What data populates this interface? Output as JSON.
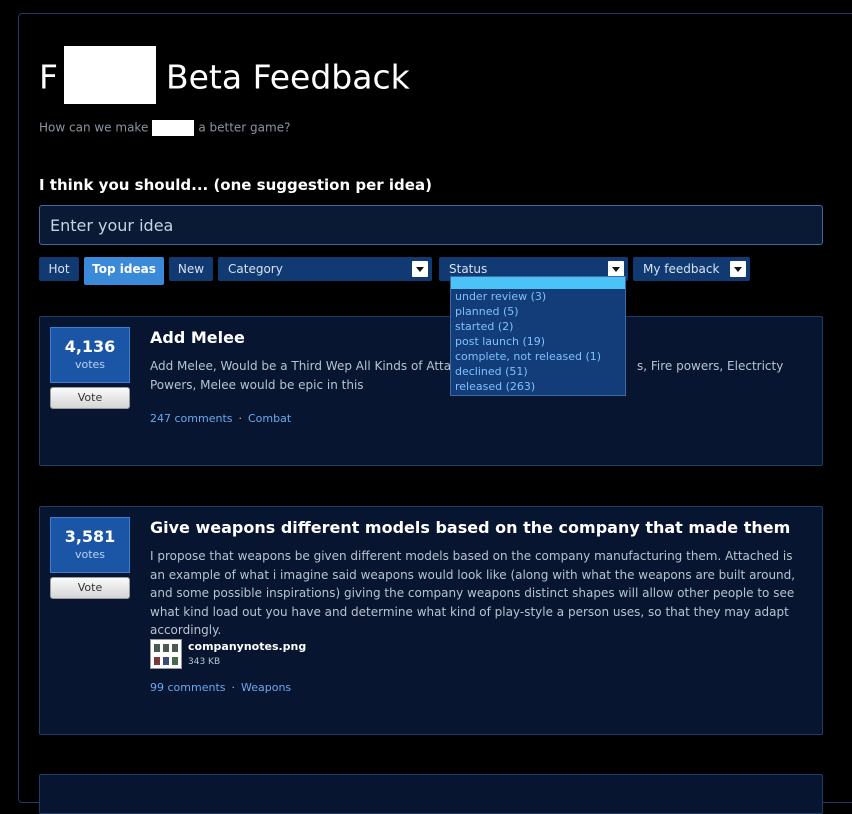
{
  "header": {
    "title_prefix": "F",
    "title_suffix": "Beta Feedback",
    "subtitle_prefix": "How can we make",
    "subtitle_suffix": "a better game?"
  },
  "prompt": "I think you should... (one suggestion per idea)",
  "idea_input": {
    "placeholder": "Enter your idea",
    "value": ""
  },
  "filters": {
    "hot": "Hot",
    "top": "Top ideas",
    "new": "New",
    "category": "Category",
    "status": "Status",
    "my_feedback": "My feedback"
  },
  "status_dropdown": {
    "options": [
      "under review (3)",
      "planned (5)",
      "started (2)",
      "post launch (19)",
      "complete, not released (1)",
      "declined (51)",
      "released (263)"
    ]
  },
  "ideas": [
    {
      "votes": "4,136",
      "votes_label": "votes",
      "vote_button": "Vote",
      "title": "Add Melee",
      "body": "Add Melee, Would be a Third Wep All Kinds of Attac                                               s, Fire powers, Electricty Powers, Melee would be epic in this",
      "comments": "247 comments",
      "category": "Combat"
    },
    {
      "votes": "3,581",
      "votes_label": "votes",
      "vote_button": "Vote",
      "title": "Give weapons different models based on the company that made them",
      "body": "I propose that weapons be given different models based on the company manufacturing them. Attached is an example of what i imagine said weapons would look like (along with what the weapons are built around, and some possible inspirations) giving the company weapons distinct shapes will allow other people to see what kind load out you have and determine what kind of play-style a person uses, so that they may adapt accordingly.",
      "attachment_name": "companynotes.png",
      "attachment_size": "343 KB",
      "comments": "99 comments",
      "category": "Weapons"
    }
  ],
  "colors": {
    "background": "#000000",
    "panel": "#071530",
    "accent": "#3b8ad9",
    "button": "#123a72",
    "link": "#6aa9f0"
  }
}
